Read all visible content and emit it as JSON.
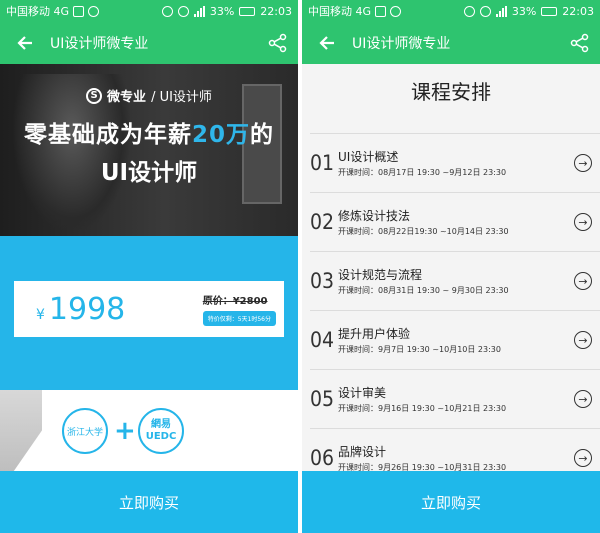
{
  "status": {
    "carrier": "中国移动 4G",
    "battery": "33%",
    "time": "22:03"
  },
  "left": {
    "title": "UI设计师微专业",
    "brand": "微专业",
    "brand_sub": "/ UI设计师",
    "headline_a": "零基础成为年薪",
    "headline_highlight": "20万",
    "headline_b": "的",
    "headline_line2": "UI设计师",
    "price": {
      "symbol": "¥",
      "amount": "1998",
      "original": "原价：¥2800",
      "promo": "特价仅剩：5天1时56分"
    },
    "partners": {
      "zju": "浙江大学",
      "uedc_top": "網易",
      "uedc_bottom": "UEDC"
    },
    "buy": "立即购买"
  },
  "right": {
    "title": "UI设计师微专业",
    "schedule_title": "课程安排",
    "courses": [
      {
        "num": "01",
        "name": "UI设计概述",
        "time": "开课时间：08月17日 19:30 ~9月12日 23:30"
      },
      {
        "num": "02",
        "name": "修炼设计技法",
        "time": "开课时间：08月22日19:30 ~10月14日 23:30"
      },
      {
        "num": "03",
        "name": "设计规范与流程",
        "time": "开课时间：08月31日 19:30 ~ 9月30日 23:30"
      },
      {
        "num": "04",
        "name": "提升用户体验",
        "time": "开课时间：9月7日 19:30 ~10月10日 23:30"
      },
      {
        "num": "05",
        "name": "设计审美",
        "time": "开课时间：9月16日 19:30 ~10月21日 23:30"
      },
      {
        "num": "06",
        "name": "品牌设计",
        "time": "开课时间：9月26日 19:30 ~10月31日 23:30"
      }
    ],
    "buy": "立即购买"
  },
  "colors": {
    "green": "#2ec46f",
    "blue": "#25b5e9",
    "buybar": "#1fb8ea"
  },
  "icons": [
    "back-arrow-icon",
    "share-icon",
    "arrow-right-circle-icon"
  ]
}
